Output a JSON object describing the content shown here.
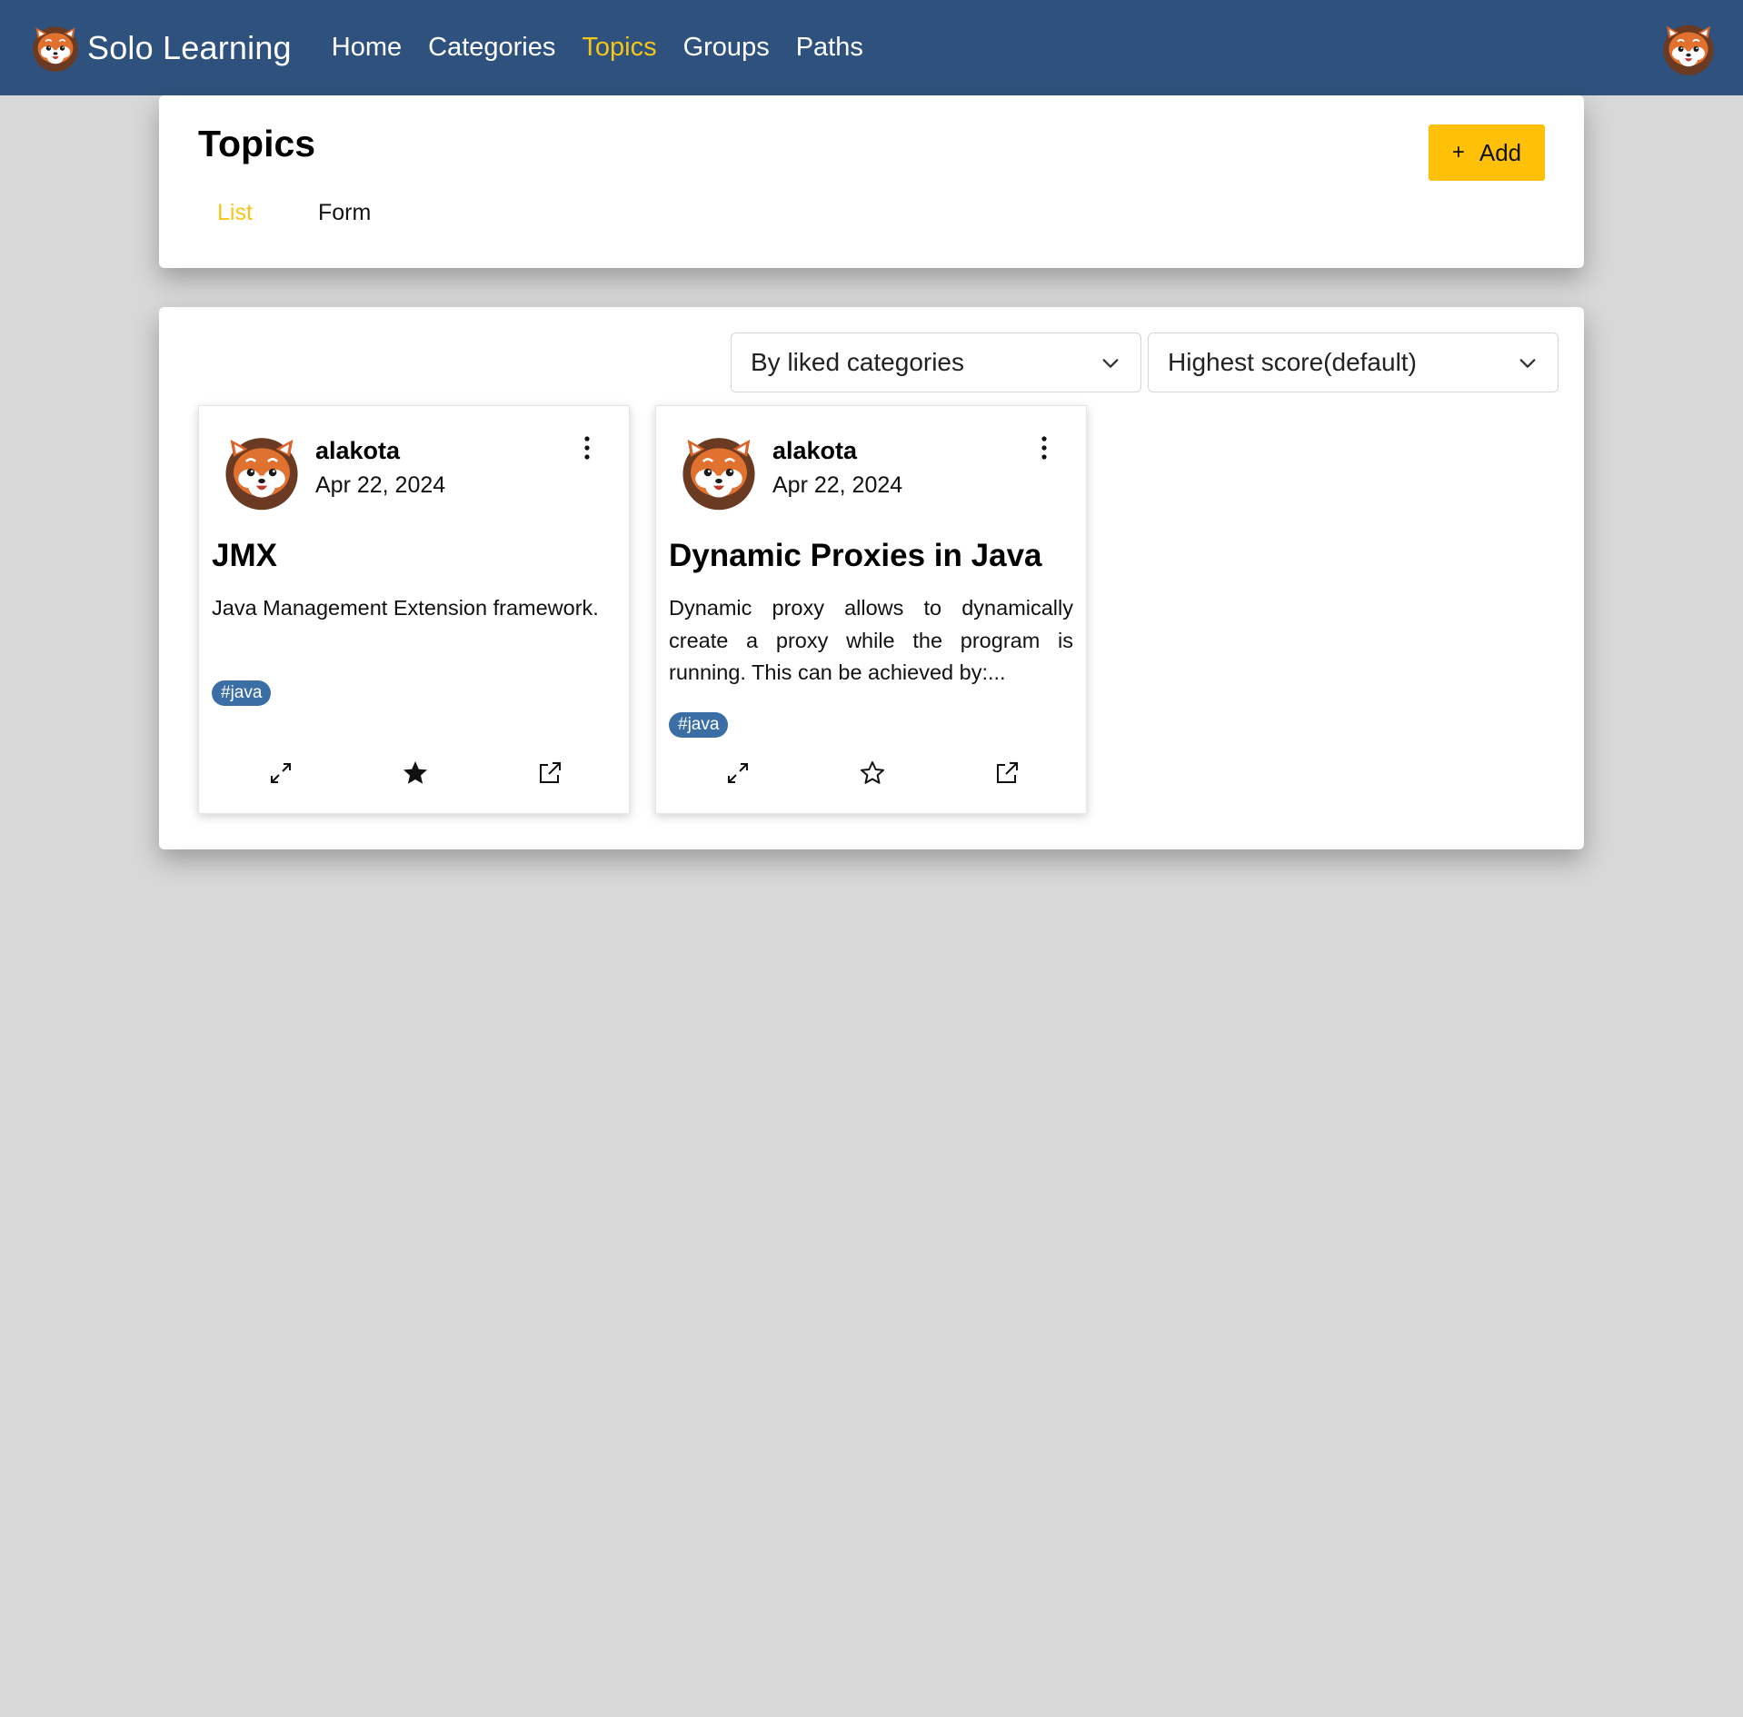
{
  "navbar": {
    "brand": "Solo Learning",
    "links": [
      "Home",
      "Categories",
      "Topics",
      "Groups",
      "Paths"
    ],
    "active": "Topics",
    "brand_icon": "red-panda-logo-icon",
    "avatar_icon": "red-panda-avatar-icon"
  },
  "header": {
    "title": "Topics",
    "tabs": [
      "List",
      "Form"
    ],
    "active_tab": "List",
    "add_label": "Add"
  },
  "filters": {
    "filter_value": "By liked categories",
    "sort_value": "Highest score(default)"
  },
  "topics": [
    {
      "author": "alakota",
      "date": "Apr 22, 2024",
      "title": "JMX",
      "description": "Java Management Extension framework.",
      "tag": "#java",
      "starred": true
    },
    {
      "author": "alakota",
      "date": "Apr 22, 2024",
      "title": "Dynamic Proxies in Java",
      "description": "Dynamic proxy allows to dynamically create a proxy while the program is running. This can be achieved by:...",
      "tag": "#java",
      "starred": false
    }
  ],
  "colors": {
    "navbar": "#2e527d",
    "accent": "#f5c518",
    "add_button": "#ffc107",
    "tag": "#3a6ea5",
    "background": "#d8d8d8"
  }
}
